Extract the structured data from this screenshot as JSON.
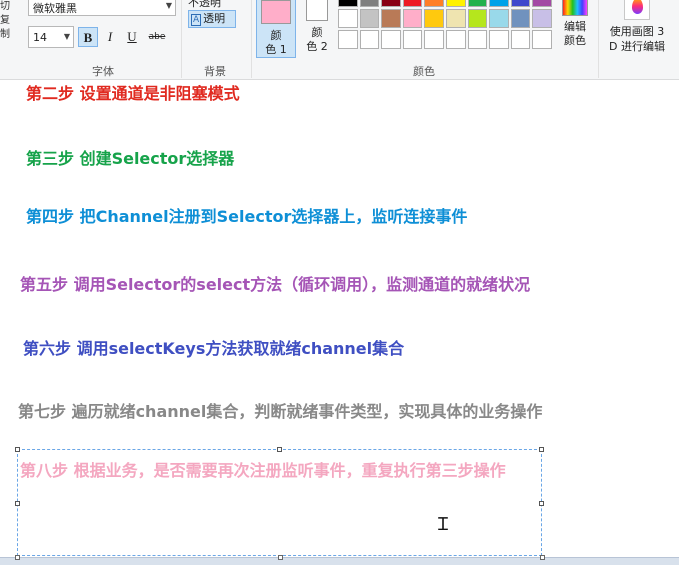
{
  "ribbon": {
    "clipboard_fragments": [
      "切",
      "复制"
    ],
    "font": {
      "family": "微软雅黑",
      "size": "14",
      "bold": "B",
      "italic": "I",
      "underline": "U",
      "strike": "abe",
      "group_label": "字体"
    },
    "background": {
      "opaque": "不透明",
      "transparent": "透明",
      "group_label": "背景"
    },
    "colors": {
      "color1_label_line1": "颜",
      "color1_label_line2": "色 1",
      "color2_label_line1": "颜",
      "color2_label_line2": "色 2",
      "color1": "#ffaec9",
      "color2": "#ffffff",
      "palette_row1": [
        "#000000",
        "#7f7f7f",
        "#880015",
        "#ed1c24",
        "#ff7f27",
        "#fff200",
        "#22b14c",
        "#00a2e8",
        "#3f48cc",
        "#a349a4"
      ],
      "palette_row2": [
        "#ffffff",
        "#c3c3c3",
        "#b97a57",
        "#ffaec9",
        "#ffc90e",
        "#efe4b0",
        "#b5e61d",
        "#99d9ea",
        "#7092be",
        "#c8bfe7"
      ],
      "palette_row3": [
        "#ffffff",
        "#ffffff",
        "#ffffff",
        "#ffffff",
        "#ffffff",
        "#ffffff",
        "#ffffff",
        "#ffffff",
        "#ffffff",
        "#ffffff"
      ],
      "edit_label_line1": "编辑",
      "edit_label_line2": "颜色",
      "group_label": "颜色"
    },
    "paint3d": {
      "line1": "使用画图 3",
      "line2": "D 进行编辑"
    }
  },
  "canvas": {
    "steps": [
      "第二步 设置通道是非阻塞模式",
      "第三步  创建Selector选择器",
      "第四步  把Channel注册到Selector选择器上，监听连接事件",
      "第五步 调用Selector的select方法（循环调用），监测通道的就绪状况",
      "第六步 调用selectKeys方法获取就绪channel集合",
      "第七步 遍历就绪channel集合，判断就绪事件类型，实现具体的业务操作",
      "第八步 根据业务，是否需要再次注册监听事件，重复执行第三步操作"
    ]
  }
}
